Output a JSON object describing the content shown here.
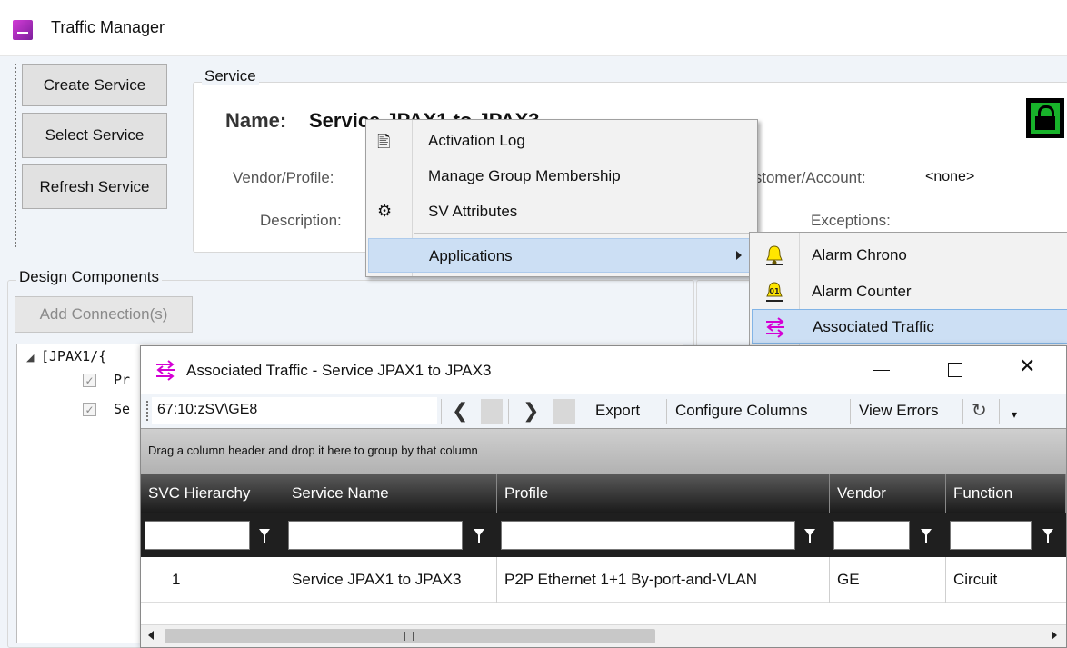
{
  "app": {
    "title": "Traffic Manager"
  },
  "toolbar": {
    "create_label": "Create Service",
    "select_label": "Select Service",
    "refresh_label": "Refresh Service"
  },
  "service": {
    "group_title": "Service",
    "name_label": "Name:",
    "name_value": "Service JPAX1 to JPAX3",
    "vendor_label": "Vendor/Profile:",
    "description_label": "Description:",
    "customer_label": "Customer/Account:",
    "customer_value": "<none>",
    "exceptions_label": "Exceptions:"
  },
  "design": {
    "group_title": "Design Components",
    "add_connection_label": "Add Connection(s)",
    "tree_root": "[JPAX1/{",
    "tree_child_1": "Pr",
    "tree_child_2": "Se"
  },
  "context_menu": {
    "items": [
      {
        "label": "Activation Log",
        "icon": "document-icon"
      },
      {
        "label": "Manage Group Membership",
        "icon": ""
      },
      {
        "label": "SV Attributes",
        "icon": "attributes-icon"
      },
      {
        "label": "Applications",
        "icon": ""
      }
    ]
  },
  "submenu": {
    "items": [
      {
        "label": "Alarm Chrono",
        "icon": "bell-icon"
      },
      {
        "label": "Alarm Counter",
        "icon": "bell-counter-icon",
        "badge": "01"
      },
      {
        "label": "Associated Traffic",
        "icon": "associated-traffic-icon"
      }
    ]
  },
  "child_window": {
    "title": "Associated Traffic - Service JPAX1 to JPAX3",
    "path": "67:10:zSV\\GE8",
    "export_label": "Export",
    "configure_label": "Configure Columns",
    "view_errors_label": "View Errors",
    "group_hint": "Drag a column header and drop it here to group by that column",
    "columns": [
      "SVC Hierarchy",
      "Service Name",
      "Profile",
      "Vendor",
      "Function"
    ],
    "rows": [
      [
        "1",
        "Service JPAX1 to JPAX3",
        "P2P Ethernet 1+1 By-port-and-VLAN",
        "GE",
        "Circuit"
      ]
    ]
  },
  "colors": {
    "accent_magenta": "#d400d4",
    "selection": "#ccdff4",
    "lock_green": "#18b22a"
  }
}
